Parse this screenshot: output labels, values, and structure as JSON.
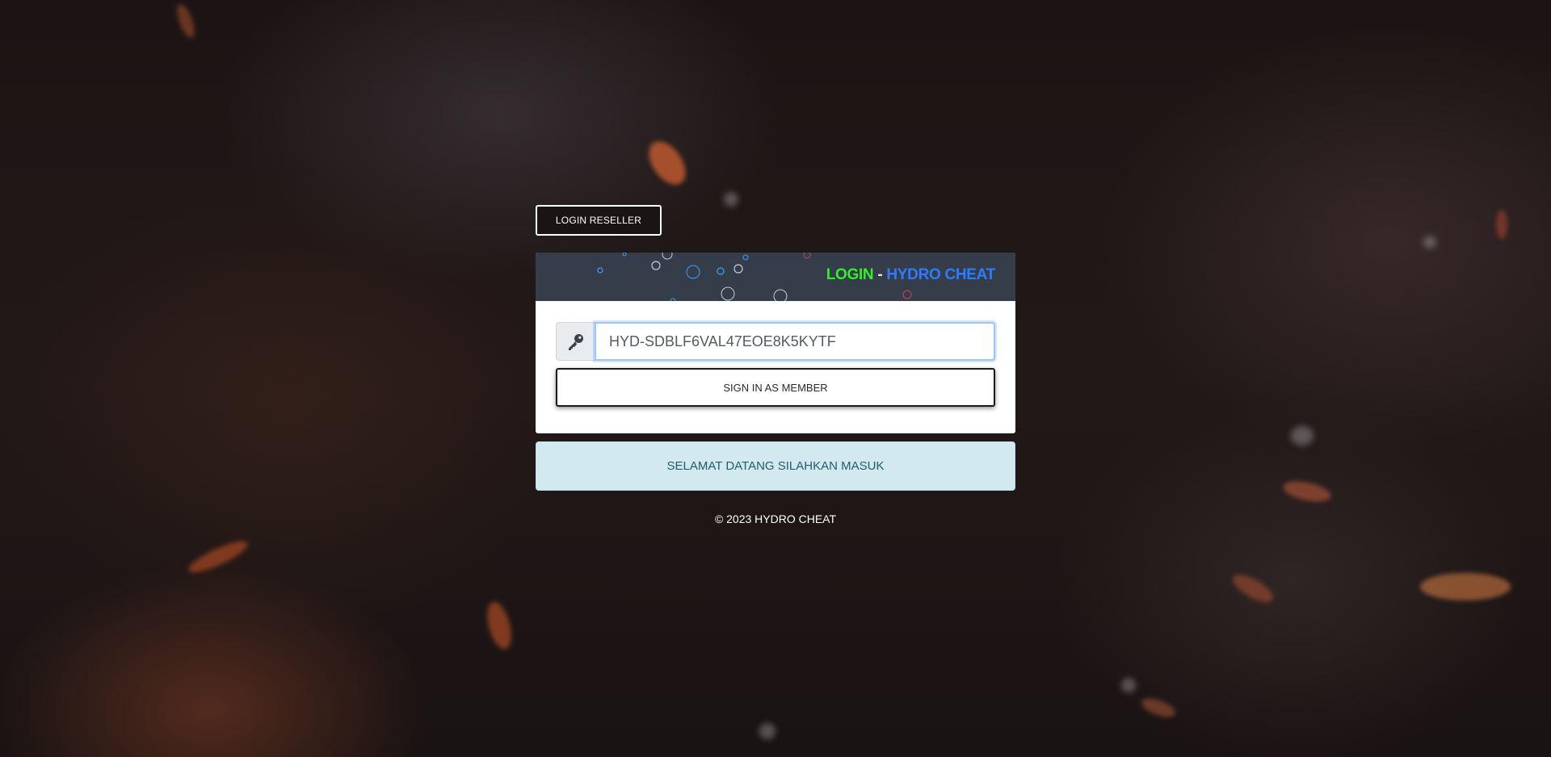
{
  "reseller_button": {
    "label": "LOGIN RESELLER"
  },
  "card": {
    "title_login": "LOGIN",
    "title_separator": " - ",
    "title_brand": "HYDRO CHEAT",
    "key_icon": "key-icon",
    "key_input": {
      "value": "HYD-SDBLF6VAL47EOE8K5KYTF"
    },
    "signin_label": "SIGN IN AS MEMBER"
  },
  "alert": {
    "text": "SELAMAT DATANG SILAHKAN MASUK"
  },
  "footer": {
    "copyright": "© 2023 HYDRO CHEAT"
  },
  "colors": {
    "title_login": "#33ee2a",
    "title_brand": "#2f7bff",
    "header_bg": "#353d4b",
    "alert_bg": "#d1e9ef",
    "alert_text": "#245c6b"
  }
}
